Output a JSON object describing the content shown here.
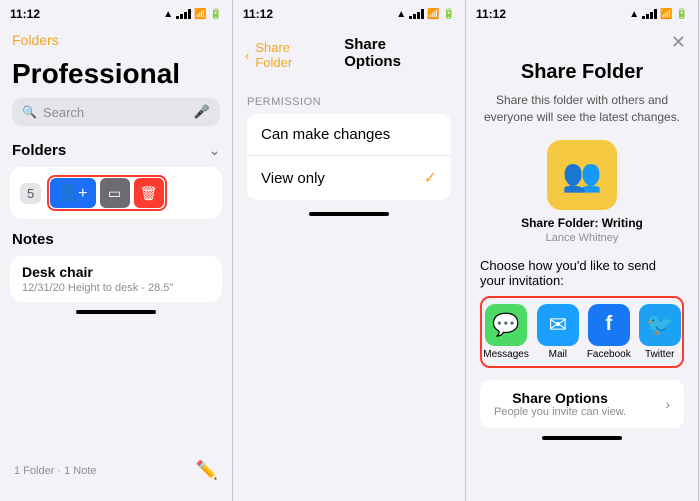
{
  "screen1": {
    "status": {
      "time": "11:12",
      "location_icon": "▲"
    },
    "back_label": "Folders",
    "title": "Professional",
    "search_placeholder": "Search",
    "sections": {
      "folders_label": "Folders",
      "folder_count": "5",
      "notes_label": "Notes"
    },
    "note": {
      "title": "Desk chair",
      "meta": "12/31/20  Height to desk - 28.5\""
    },
    "footer": {
      "summary": "1 Folder · 1 Note",
      "compose_icon": "✏"
    },
    "actions": {
      "share_icon": "👤+",
      "edit_icon": "▭",
      "delete_icon": "🗑"
    }
  },
  "screen2": {
    "status": {
      "time": "11:12"
    },
    "nav": {
      "back_label": "Share Folder",
      "title": "Share Options"
    },
    "permission_label": "PERMISSION",
    "options": [
      {
        "label": "Can make changes",
        "checked": false
      },
      {
        "label": "View only",
        "checked": true
      }
    ]
  },
  "screen3": {
    "status": {
      "time": "11:12"
    },
    "close_icon": "✕",
    "title": "Share Folder",
    "description": "Share this folder with others and everyone will see the latest changes.",
    "folder_icon": "👥",
    "folder_label": "Share Folder: Writing",
    "folder_sublabel": "Lance Whitney",
    "invite_label": "Choose how you'd like to send your invitation:",
    "apps": [
      {
        "name": "Messages",
        "icon": "💬",
        "class": "messages"
      },
      {
        "name": "Mail",
        "icon": "✉",
        "class": "mail"
      },
      {
        "name": "Facebook",
        "icon": "f",
        "class": "facebook"
      },
      {
        "name": "Twitter",
        "icon": "🐦",
        "class": "twitter"
      }
    ],
    "share_options": {
      "title": "Share Options",
      "subtitle": "People you invite can view.",
      "chevron": "›"
    }
  }
}
